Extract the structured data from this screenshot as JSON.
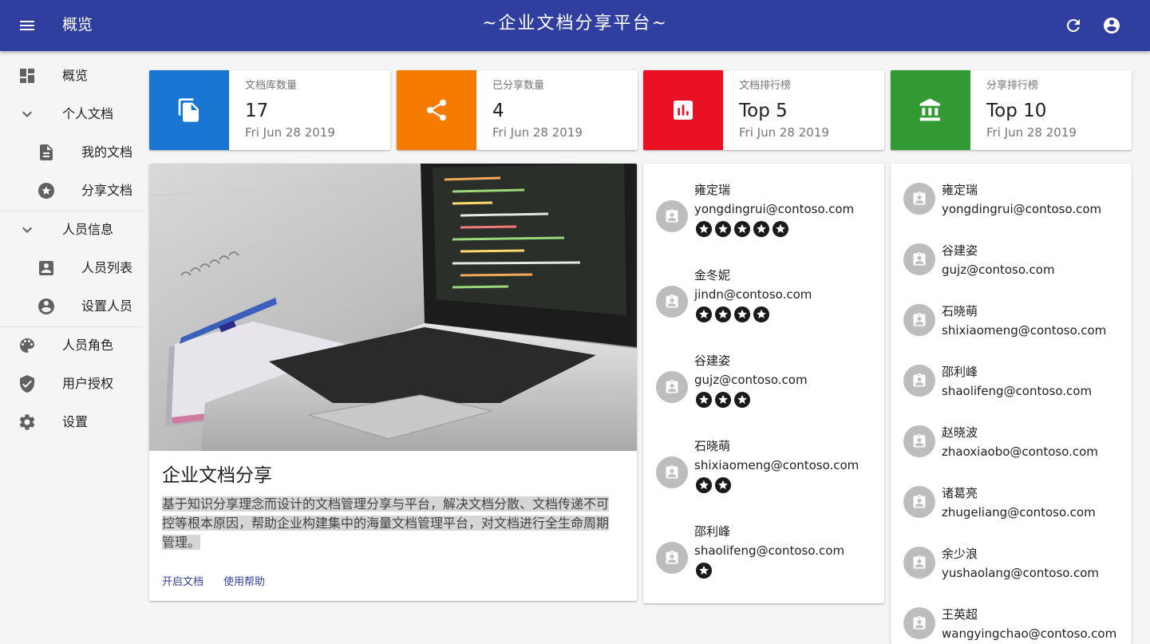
{
  "header": {
    "page_title": "概览",
    "app_title": "~企业文档分享平台~",
    "bar_color": "#303f9f"
  },
  "sidebar": {
    "items": [
      {
        "label": "概览",
        "icon": "dashboard-icon"
      },
      {
        "label": "个人文档",
        "icon": "chevron-down-icon"
      },
      {
        "label": "我的文档",
        "icon": "file-icon"
      },
      {
        "label": "分享文档",
        "icon": "star-circle-icon"
      },
      {
        "label": "人员信息",
        "icon": "chevron-down-icon"
      },
      {
        "label": "人员列表",
        "icon": "contact-card-icon"
      },
      {
        "label": "设置人员",
        "icon": "account-circle-icon"
      },
      {
        "label": "人员角色",
        "icon": "palette-icon"
      },
      {
        "label": "用户授权",
        "icon": "shield-check-icon"
      },
      {
        "label": "设置",
        "icon": "gear-icon"
      }
    ]
  },
  "stats": [
    {
      "title": "文档库数量",
      "value": "17",
      "date": "Fri Jun 28 2019",
      "color": "#1976d2",
      "icon": "file-copy-icon"
    },
    {
      "title": "已分享数量",
      "value": "4",
      "date": "Fri Jun 28 2019",
      "color": "#f57c00",
      "icon": "share-icon"
    },
    {
      "title": "文档排行榜",
      "value": "Top 5",
      "date": "Fri Jun 28 2019",
      "color": "#e91123",
      "icon": "bar-chart-icon"
    },
    {
      "title": "分享排行榜",
      "value": "Top 10",
      "date": "Fri Jun 28 2019",
      "color": "#339933",
      "icon": "bank-icon"
    }
  ],
  "main_card": {
    "title": "企业文档分享",
    "description": "基于知识分享理念而设计的文档管理分享与平台，解决文档分散、文档传递不可控等根本原因，帮助企业构建集中的海量文档管理平台，对文档进行全生命周期管理。",
    "actions": [
      "开启文档",
      "使用帮助"
    ]
  },
  "doc_ranking": [
    {
      "name": "雍定瑞",
      "email": "yongdingrui@contoso.com",
      "stars": 5
    },
    {
      "name": "金冬妮",
      "email": "jindn@contoso.com",
      "stars": 4
    },
    {
      "name": "谷建姿",
      "email": "gujz@contoso.com",
      "stars": 3
    },
    {
      "name": "石晓萌",
      "email": "shixiaomeng@contoso.com",
      "stars": 2
    },
    {
      "name": "邵利峰",
      "email": "shaolifeng@contoso.com",
      "stars": 1
    }
  ],
  "share_ranking": [
    {
      "name": "雍定瑞",
      "email": "yongdingrui@contoso.com"
    },
    {
      "name": "谷建姿",
      "email": "gujz@contoso.com"
    },
    {
      "name": "石晓萌",
      "email": "shixiaomeng@contoso.com"
    },
    {
      "name": "邵利峰",
      "email": "shaolifeng@contoso.com"
    },
    {
      "name": "赵晓波",
      "email": "zhaoxiaobo@contoso.com"
    },
    {
      "name": "诸葛亮",
      "email": "zhugeliang@contoso.com"
    },
    {
      "name": "余少浪",
      "email": "yushaolang@contoso.com"
    },
    {
      "name": "王英超",
      "email": "wangyingchao@contoso.com"
    }
  ]
}
